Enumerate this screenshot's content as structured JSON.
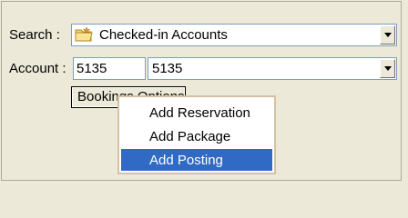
{
  "search": {
    "label": "Search :",
    "value": "Checked-in Accounts",
    "icon": "folder-star-icon"
  },
  "account": {
    "label": "Account :",
    "number": "5135",
    "selected": "5135"
  },
  "bookings_button": {
    "label": "Bookings Options"
  },
  "context_menu": {
    "items": [
      {
        "label": "Add Reservation",
        "selected": false
      },
      {
        "label": "Add Package",
        "selected": false
      },
      {
        "label": "Add Posting",
        "selected": true
      }
    ],
    "highlight_color": "#316ac5"
  }
}
